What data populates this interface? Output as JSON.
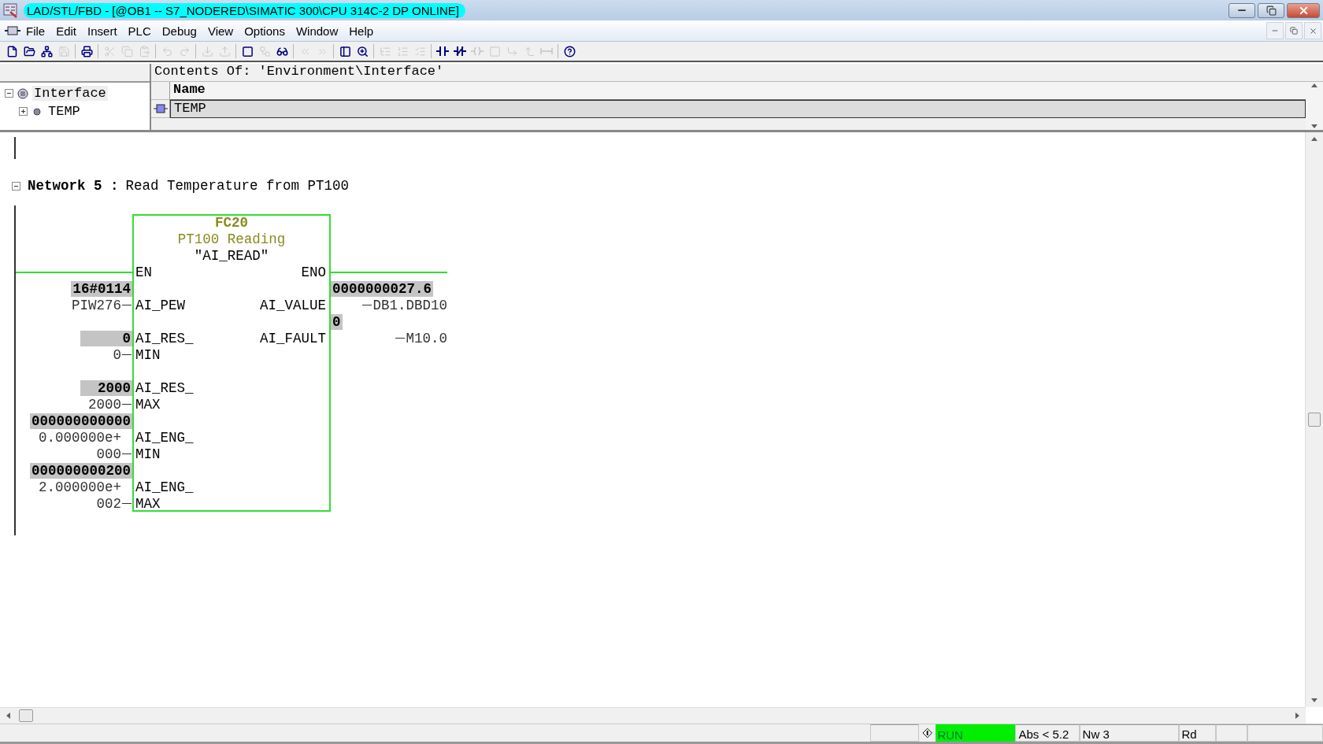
{
  "window": {
    "title": "LAD/STL/FBD  - [@OB1 -- S7_NODERED\\SIMATIC 300\\CPU 314C-2 DP  ONLINE]"
  },
  "menu": [
    "File",
    "Edit",
    "Insert",
    "PLC",
    "Debug",
    "View",
    "Options",
    "Window",
    "Help"
  ],
  "toolbar": [
    {
      "kind": "button",
      "disabled": false
    },
    {
      "kind": "button",
      "disabled": false
    },
    {
      "kind": "button",
      "disabled": false
    },
    {
      "kind": "button",
      "disabled": true
    },
    {
      "kind": "separator"
    },
    {
      "kind": "button",
      "disabled": false
    },
    {
      "kind": "separator"
    },
    {
      "kind": "button",
      "disabled": true
    },
    {
      "kind": "button",
      "disabled": true
    },
    {
      "kind": "button",
      "disabled": true
    },
    {
      "kind": "separator"
    },
    {
      "kind": "button",
      "disabled": true
    },
    {
      "kind": "button",
      "disabled": true
    },
    {
      "kind": "separator"
    },
    {
      "kind": "button",
      "disabled": true
    },
    {
      "kind": "button",
      "disabled": true
    },
    {
      "kind": "separator"
    },
    {
      "kind": "button",
      "disabled": false
    },
    {
      "kind": "button",
      "disabled": true
    },
    {
      "kind": "button",
      "disabled": false
    },
    {
      "kind": "separator"
    },
    {
      "kind": "button",
      "disabled": true
    },
    {
      "kind": "button",
      "disabled": true
    },
    {
      "kind": "separator"
    },
    {
      "kind": "button",
      "disabled": false
    },
    {
      "kind": "button",
      "disabled": false
    },
    {
      "kind": "separator"
    },
    {
      "kind": "button",
      "disabled": true
    },
    {
      "kind": "button",
      "disabled": true
    },
    {
      "kind": "button",
      "disabled": true
    },
    {
      "kind": "separator"
    },
    {
      "kind": "button",
      "disabled": false
    },
    {
      "kind": "button",
      "disabled": false
    },
    {
      "kind": "button",
      "disabled": true
    },
    {
      "kind": "button",
      "disabled": true
    },
    {
      "kind": "button",
      "disabled": true
    },
    {
      "kind": "button",
      "disabled": true
    },
    {
      "kind": "button",
      "disabled": true
    },
    {
      "kind": "separator"
    },
    {
      "kind": "button",
      "disabled": false
    }
  ],
  "interface": {
    "tree": [
      {
        "label": "Interface",
        "expanded": true,
        "children": [
          {
            "label": "TEMP",
            "expanded": false
          }
        ]
      }
    ],
    "contents_title": "Contents Of: 'Environment\\Interface'",
    "columns": [
      "Name"
    ],
    "rows": [
      {
        "name": "TEMP",
        "selected": true
      }
    ]
  },
  "network": {
    "expanded": true,
    "title": "Network 5 :",
    "comment": "Read Temperature from PT100",
    "block": {
      "number": "FC20",
      "title": "PT100 Reading",
      "symbol": "\"AI_READ\"",
      "enable_in": "EN",
      "enable_out": "ENO",
      "energized": true,
      "inputs": [
        {
          "pin": [
            "AI_PEW"
          ],
          "address": [
            "PIW276"
          ],
          "value": "16#0114"
        },
        {
          "pin": [
            "AI_RES_",
            "MIN"
          ],
          "address": [
            "0"
          ],
          "value": "0"
        },
        {
          "pin": [
            "AI_RES_",
            "MAX"
          ],
          "address": [
            "2000"
          ],
          "value": "2000"
        },
        {
          "pin": [
            "AI_ENG_",
            "MIN"
          ],
          "address": [
            "0.000000e+",
            "000"
          ],
          "value": "000000000000"
        },
        {
          "pin": [
            "AI_ENG_",
            "MAX"
          ],
          "address": [
            "2.000000e+",
            "002"
          ],
          "value": "000000000200"
        }
      ],
      "outputs": [
        {
          "pin": [
            "AI_VALUE"
          ],
          "address": [
            "DB1.DBD10"
          ],
          "value": "0000000027.6"
        },
        {
          "pin": [
            "AI_FAULT"
          ],
          "address": [
            "M10.0"
          ],
          "value": "0"
        }
      ]
    }
  },
  "status_bar": {
    "mode": "RUN",
    "running": true,
    "fields": [
      "Abs < 5.2",
      "Nw 3",
      "Rd"
    ]
  }
}
